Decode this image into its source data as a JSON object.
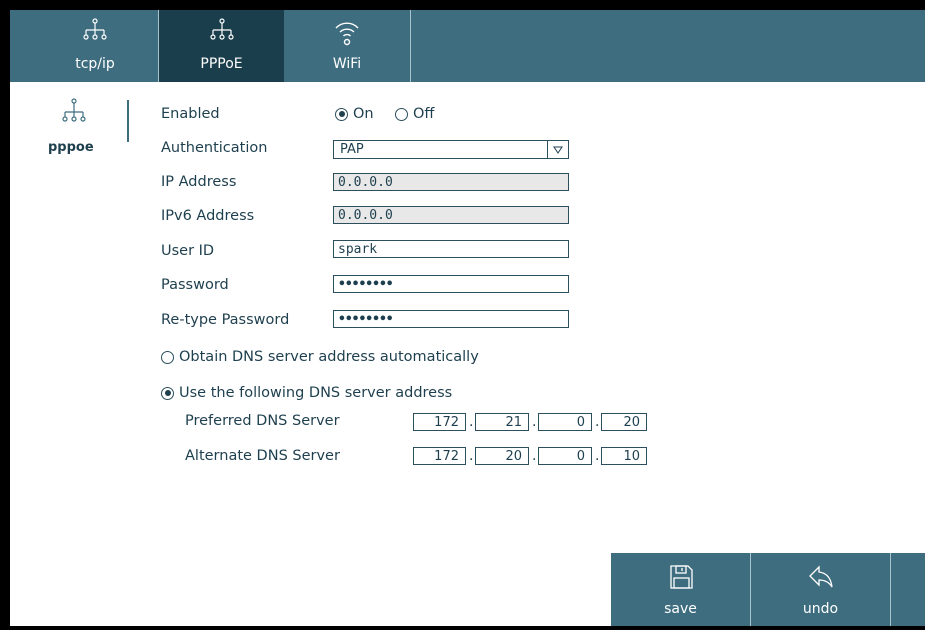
{
  "tabs": [
    {
      "label": "tcp/ip",
      "icon": "network-icon"
    },
    {
      "label": "PPPoE",
      "icon": "network-icon",
      "active": true
    },
    {
      "label": "WiFi",
      "icon": "wifi-icon"
    }
  ],
  "sidenav": {
    "label": "pppoe",
    "icon": "network-icon"
  },
  "form": {
    "enabled_label": "Enabled",
    "enabled_on": "On",
    "enabled_off": "Off",
    "enabled_value": "On",
    "auth_label": "Authentication",
    "auth_value": "PAP",
    "ip_label": "IP Address",
    "ip_value": "0.0.0.0",
    "ipv6_label": "IPv6 Address",
    "ipv6_value": "0.0.0.0",
    "userid_label": "User ID",
    "userid_value": "spark",
    "password_label": "Password",
    "password_value": "••••••••",
    "retype_label": "Re-type Password",
    "retype_value": "••••••••"
  },
  "dns": {
    "auto_label": "Obtain DNS server address automatically",
    "manual_label": "Use the following DNS server address",
    "selected": "manual",
    "preferred_label": "Preferred DNS Server",
    "preferred": [
      "172",
      "21",
      "0",
      "20"
    ],
    "alternate_label": "Alternate DNS Server",
    "alternate": [
      "172",
      "20",
      "0",
      "10"
    ]
  },
  "actions": {
    "save_label": "save",
    "undo_label": "undo"
  },
  "colors": {
    "bar": "#3e6d80",
    "active_tab": "#1b3e4d",
    "text": "#1e3f4e"
  }
}
